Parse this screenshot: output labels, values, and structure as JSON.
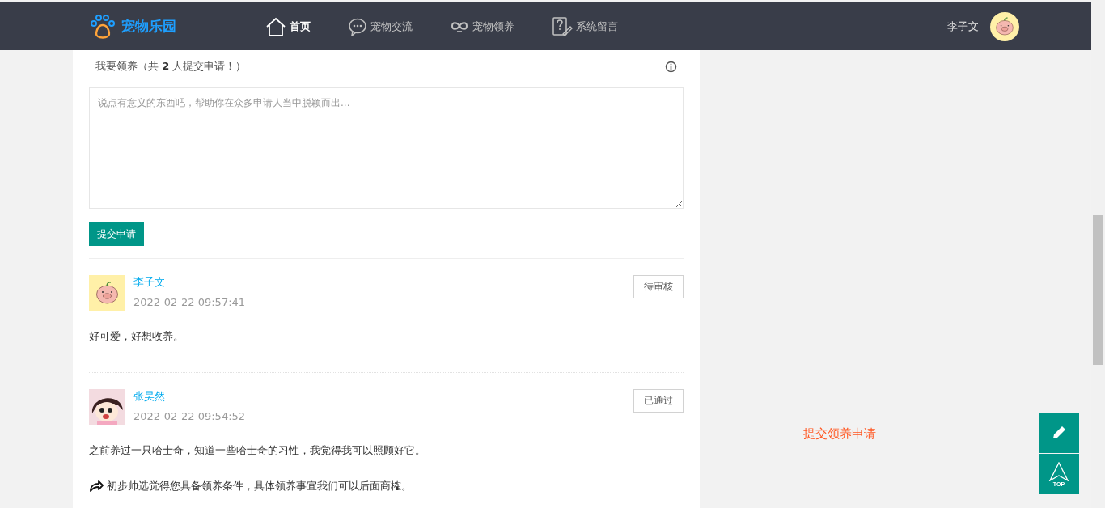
{
  "header": {
    "logo": "宠物乐园",
    "nav": [
      {
        "label": "首页",
        "kind": "home",
        "selected": true
      },
      {
        "label": "宠物交流",
        "kind": "chat",
        "selected": false
      },
      {
        "label": "宠物领养",
        "kind": "link",
        "selected": false
      },
      {
        "label": "系统留言",
        "kind": "note",
        "selected": false
      }
    ],
    "user": "李子文"
  },
  "adopt": {
    "title": "我要领养（共 **2** 人提交申请！）",
    "placeholder": "说点有意义的东西吧，帮助你在众多申请人当中脱颖而出...",
    "submit": "提交申请"
  },
  "applications": [
    {
      "name": "李子文",
      "kind": "pig",
      "time": "2022-02-22 09:57:41",
      "status": "待审核",
      "text": "好可爱，好想收养。"
    },
    {
      "name": "张昊然",
      "kind": "girl",
      "time": "2022-02-22 09:54:52",
      "status": "已通过",
      "text": "之前养过一只哈士奇，知道一些哈士奇的习性，我觉得我可以照顾好它。",
      "reply": "初步帅选觉得您具备领养条件，具体领养事宜我们可以后面商榷。"
    }
  ],
  "side_note": "提交领养申请",
  "top_button": {
    "label": "TOP"
  }
}
